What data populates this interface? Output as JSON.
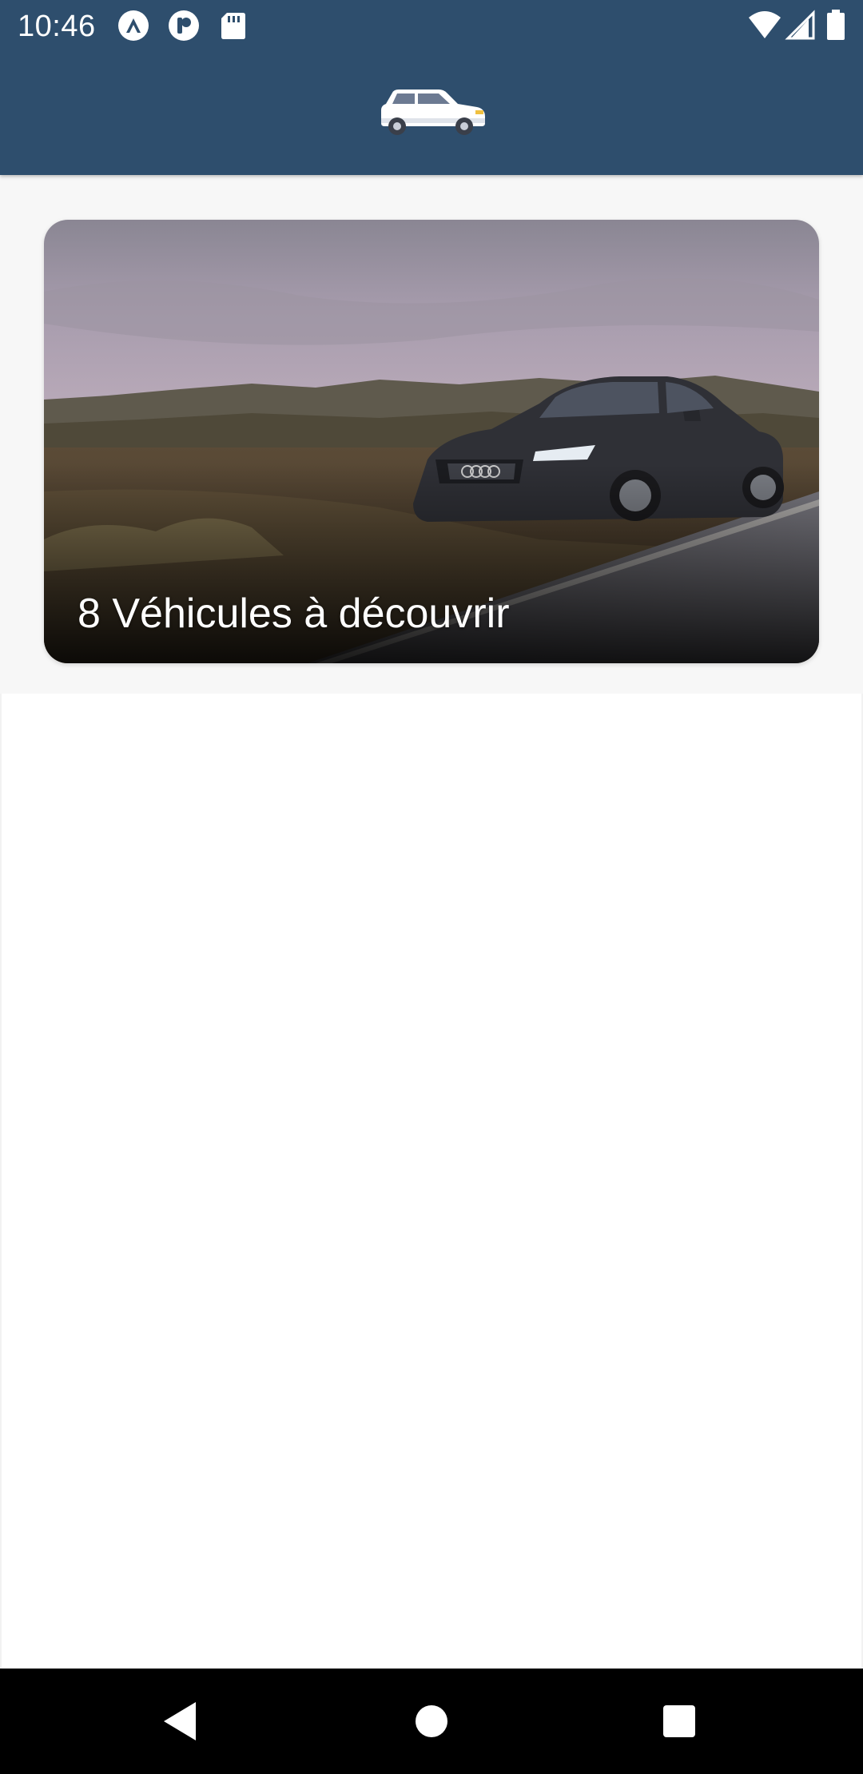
{
  "status_bar": {
    "time": "10:46",
    "left_icons": [
      "app-notification-icon",
      "pocket-app-icon",
      "sd-card-icon"
    ],
    "right_icons": [
      "wifi-icon",
      "cell-signal-icon",
      "battery-icon"
    ]
  },
  "app_bar": {
    "logo_icon": "car-icon",
    "background_color": "#2e4e6d"
  },
  "hero_card": {
    "title": "8 Véhicules à découvrir",
    "image": "dark-sedan-on-road-photo"
  },
  "navigation_bar": {
    "buttons": [
      "back",
      "home",
      "recents"
    ]
  },
  "colors": {
    "primary": "#2e4e6d",
    "background": "#f7f7f7",
    "text_on_image": "#ffffff"
  }
}
